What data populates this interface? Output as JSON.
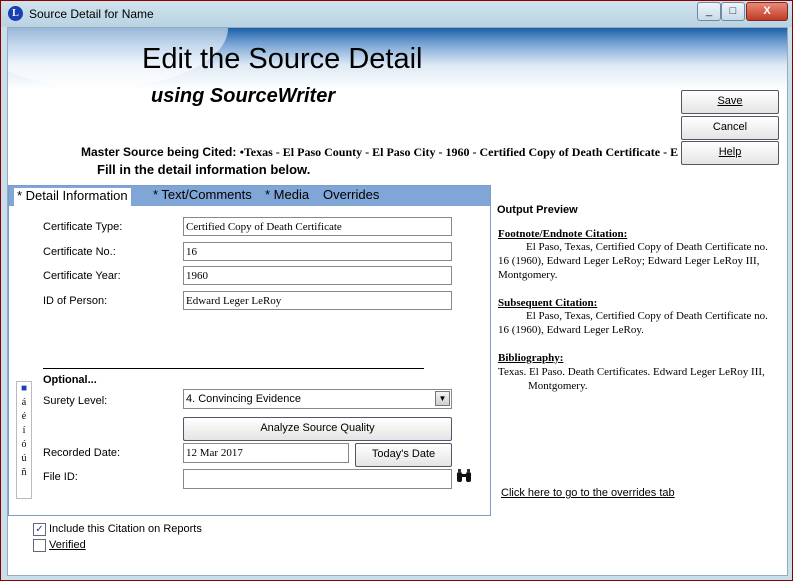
{
  "window": {
    "title": "Source Detail for Name",
    "app_icon": "L",
    "minimize": "_",
    "maximize": "□",
    "close": "X"
  },
  "header": {
    "title": "Edit the Source Detail",
    "subtitle": "using SourceWriter"
  },
  "buttons": {
    "save": "Save",
    "cancel": "Cancel",
    "help": "Help"
  },
  "master": {
    "label": "Master Source being Cited: ",
    "value": "•Texas - El Paso County - El Paso City - 1960 - Certified Copy of Death Certificate - E"
  },
  "instruction": "Fill in the detail information below.",
  "tabs": [
    "* Detail Information",
    "* Text/Comments",
    "* Media",
    "Overrides"
  ],
  "fields": [
    {
      "label": "Certificate Type:",
      "value": "Certified Copy of Death Certificate"
    },
    {
      "label": "Certificate No.:",
      "value": "16"
    },
    {
      "label": "Certificate Year:",
      "value": "1960"
    },
    {
      "label": "ID of Person:",
      "value": "Edward Leger LeRoy"
    }
  ],
  "optional": {
    "heading": "Optional...",
    "surety_label": "Surety Level:",
    "surety_value": "4.  Convincing Evidence",
    "analyze_button": "Analyze Source Quality",
    "recorded_label": "Recorded Date:",
    "recorded_value": "12 Mar 2017",
    "today_button": "Today's Date",
    "fileid_label": "File ID:",
    "fileid_value": ""
  },
  "side_chars": [
    "■",
    "á",
    "é",
    "í",
    "ó",
    "ú",
    "ñ"
  ],
  "preview": {
    "title": "Output Preview",
    "footnote_heading": "Footnote/Endnote Citation:",
    "footnote_text": "El Paso, Texas, Certified Copy of Death Certificate no. 16 (1960), Edward Leger LeRoy; Edward Leger LeRoy III, Montgomery.",
    "subsequent_heading": "Subsequent Citation:",
    "subsequent_text": "El Paso, Texas, Certified Copy of Death Certificate no. 16 (1960), Edward Leger LeRoy.",
    "bibliography_heading": "Bibliography:",
    "bibliography_text": "Texas. El Paso. Death Certificates. Edward Leger LeRoy III, Montgomery.",
    "overrides_link": "Click here to go to the overrides tab"
  },
  "checkboxes": [
    {
      "label": "Include this Citation on Reports",
      "checked": true
    },
    {
      "label": "Verified",
      "checked": false
    }
  ],
  "icons": {
    "binoculars": "binoculars-icon",
    "dropdown": "chevron-down-icon"
  }
}
